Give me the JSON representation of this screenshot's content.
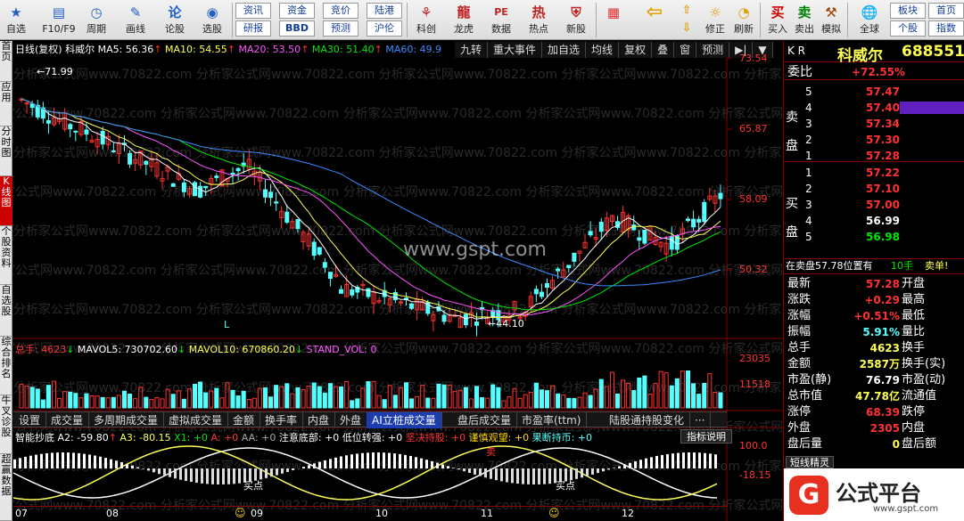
{
  "toolbar": {
    "left_buttons": [
      {
        "label": "自选",
        "icon": "star-icon"
      },
      {
        "label": "F10/F9",
        "icon": "f10-icon"
      },
      {
        "label": "周期",
        "icon": "clock-icon"
      },
      {
        "label": "画线",
        "icon": "pencil-icon"
      },
      {
        "label": "论股",
        "icon": "discuss-icon"
      },
      {
        "label": "选股",
        "icon": "select-icon"
      }
    ],
    "grid_buttons": [
      "资讯",
      "资金",
      "竞价",
      "陆港",
      "研报",
      "BBD",
      "预测",
      "沪伦"
    ],
    "mid_buttons": [
      {
        "label": "科创",
        "icon": "kechuang-icon"
      },
      {
        "label": "龙虎",
        "icon": "dragon-icon"
      },
      {
        "label": "数据",
        "icon": "pe-icon"
      },
      {
        "label": "热点",
        "icon": "hot-icon"
      },
      {
        "label": "新股",
        "icon": "newstock-icon"
      }
    ],
    "right_buttons": [
      {
        "label": "",
        "icon": "color-grid-icon"
      },
      {
        "label": "",
        "icon": "back-arrow-icon"
      },
      {
        "label": "",
        "icon": "up-down-icon"
      },
      {
        "label": "修正",
        "icon": "fix-icon"
      },
      {
        "label": "刷新",
        "icon": "refresh-icon"
      },
      {
        "label": "买入",
        "icon": "buy-icon",
        "glyph": "买"
      },
      {
        "label": "卖出",
        "icon": "sell-icon",
        "glyph": "卖"
      },
      {
        "label": "模拟",
        "icon": "simulate-icon"
      },
      {
        "label": "全球",
        "icon": "globe-icon"
      }
    ],
    "far_right": [
      "板块",
      "首页",
      "个股",
      "指数"
    ]
  },
  "left_tabs": [
    "首页",
    "应用",
    "分时图",
    "K线图",
    "个股资料",
    "自选股",
    "综合排名",
    "牛叉诊股",
    "超赢数据"
  ],
  "header": {
    "title": "日线(复权)",
    "stock": "科威尔",
    "ma5": "MA5: 56.36",
    "ma10": "MA10: 54.55",
    "ma20": "MA20: 53.50",
    "ma30": "MA30: 51.40",
    "ma60": "MA60: 49.9",
    "buttons": [
      "九转",
      "重大事件",
      "加自选",
      "均线",
      "复权",
      "叠",
      "窗",
      "预测"
    ]
  },
  "price_axis": [
    "73.54",
    "65.87",
    "58.09",
    "50.32"
  ],
  "annotations": {
    "high": "71.99",
    "low": "44.10",
    "marker": "L",
    "watermark": "www.gspt.com",
    "bg_watermark": "分析家公式网www.70822.com"
  },
  "volume": {
    "label": "总手: 4623",
    "mavol5": "MAVOL5: 730702.60",
    "mavol10": "MAVOL10: 670860.20",
    "stand": "STAND_VOL: 0",
    "axis": [
      "23035",
      "11518"
    ]
  },
  "tabs": [
    "设置",
    "成交量",
    "多周期成交量",
    "虚拟成交量",
    "金额",
    "换手率",
    "内盘",
    "外盘",
    "AI立桩成交量",
    "盘后成交量",
    "市盈率(ttm)",
    "陆股通持股变化",
    "···"
  ],
  "indicator": {
    "name": "智能抄底",
    "a2": "A2: -59.80",
    "a3": "A3: -80.15",
    "x1": "X1: +0",
    "a": "A: +0",
    "aa": "AA: +0",
    "bottom": "注意底部: +0",
    "low": "低位转强: +0",
    "hold": "坚决持股: +0",
    "cautious": "谨慎观望: +0",
    "sell": "果断持币: +0",
    "help": "指标说明",
    "axis": [
      "100.0",
      "-18.15"
    ],
    "buy_label": "买点",
    "sell_label": "卖"
  },
  "time_axis": [
    "07",
    "08",
    "09",
    "10",
    "11",
    "12"
  ],
  "quote": {
    "market": "K R",
    "name": "科威尔",
    "code": "688551",
    "weibi_label": "委比",
    "weibi": "+72.55%",
    "sell_label": "卖盘",
    "buy_label": "买盘",
    "asks": [
      {
        "n": "5",
        "price": "57.47"
      },
      {
        "n": "4",
        "price": "57.40"
      },
      {
        "n": "3",
        "price": "57.34"
      },
      {
        "n": "2",
        "price": "57.30"
      },
      {
        "n": "1",
        "price": "57.28"
      }
    ],
    "bids": [
      {
        "n": "1",
        "price": "57.22"
      },
      {
        "n": "2",
        "price": "57.10"
      },
      {
        "n": "3",
        "price": "57.00"
      },
      {
        "n": "4",
        "price": "56.99"
      },
      {
        "n": "5",
        "price": "56.98"
      }
    ],
    "status": "在卖盘57.78位置有",
    "status_hands": "10手",
    "status_action": "卖单!",
    "stats": [
      {
        "l": "最新",
        "v": "57.28",
        "r": "开盘"
      },
      {
        "l": "涨跌",
        "v": "+0.29",
        "r": "最高"
      },
      {
        "l": "涨幅",
        "v": "+0.51%",
        "r": "最低"
      },
      {
        "l": "振幅",
        "v": "5.91%",
        "r": "量比"
      },
      {
        "l": "总手",
        "v": "4623",
        "r": "换手"
      },
      {
        "l": "金额",
        "v": "2587万",
        "r": "换手(实)"
      },
      {
        "l": "市盈(静)",
        "v": "76.79",
        "r": "市盈(动)"
      },
      {
        "l": "总市值",
        "v": "47.78亿",
        "r": "流通值"
      },
      {
        "l": "涨停",
        "v": "68.39",
        "r": "跌停"
      },
      {
        "l": "外盘",
        "v": "2305",
        "r": "内盘"
      },
      {
        "l": "盘后量",
        "v": "0",
        "r": "盘后额"
      }
    ],
    "bottom_tab": "短线精灵",
    "logo_text": "公式平台",
    "logo_url": "www.gspt.com"
  },
  "colors": {
    "up": "#ff3232",
    "down": "#54ffff",
    "ma5": "#ffffff",
    "ma10": "#ffff54",
    "ma20": "#ff54ff",
    "ma30": "#00e600",
    "ma60": "#3c8cff"
  }
}
